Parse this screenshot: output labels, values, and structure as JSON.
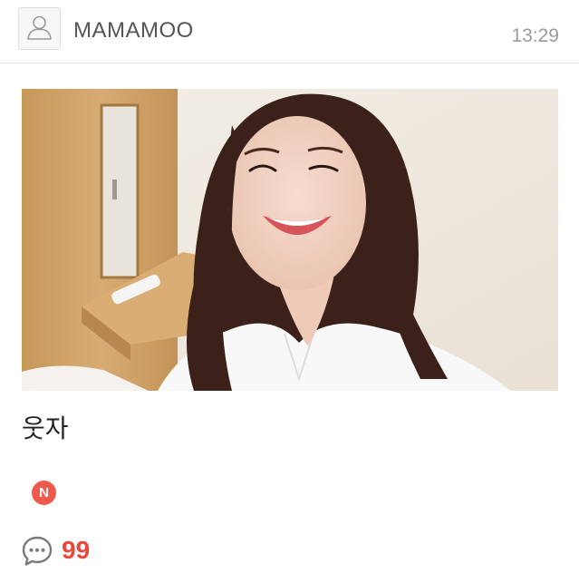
{
  "header": {
    "avatar_icon": "user-silhouette-icon",
    "author": "MAMAMOO",
    "time": "13:29"
  },
  "post": {
    "photo": "selfie photo",
    "caption": "웃자",
    "badge": "N",
    "comment_icon": "speech-bubble-icon",
    "comment_count": "99"
  },
  "colors": {
    "badge_bg": "#ee5a4b",
    "comment_count": "#e8483a",
    "divider": "#e3e3e3"
  }
}
